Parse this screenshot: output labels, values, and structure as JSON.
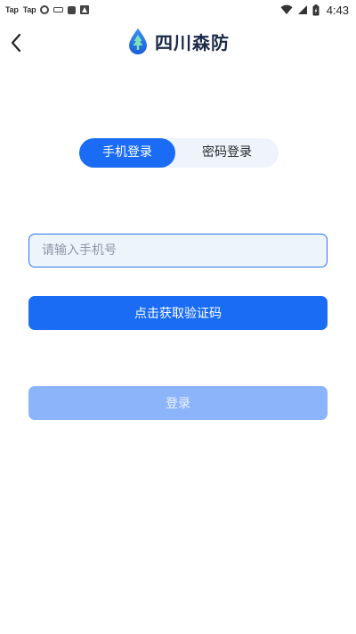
{
  "status_bar": {
    "notif_1": "Tap",
    "notif_2": "Tap",
    "time": "4:43"
  },
  "header": {
    "title": "四川森防",
    "back_icon": "chevron-left-icon",
    "logo_icon": "tree-drop-logo"
  },
  "tabs": [
    {
      "label": "手机登录",
      "active": true
    },
    {
      "label": "密码登录",
      "active": false
    }
  ],
  "phone": {
    "value": "",
    "placeholder": "请输入手机号"
  },
  "buttons": {
    "get_code": "点击获取验证码",
    "login": "登录"
  },
  "colors": {
    "primary": "#1a6cf5",
    "primary_disabled": "#8cb4fb",
    "tab_bg": "#eef3fc",
    "input_bg": "#eef4fc",
    "title": "#1b2a48"
  }
}
